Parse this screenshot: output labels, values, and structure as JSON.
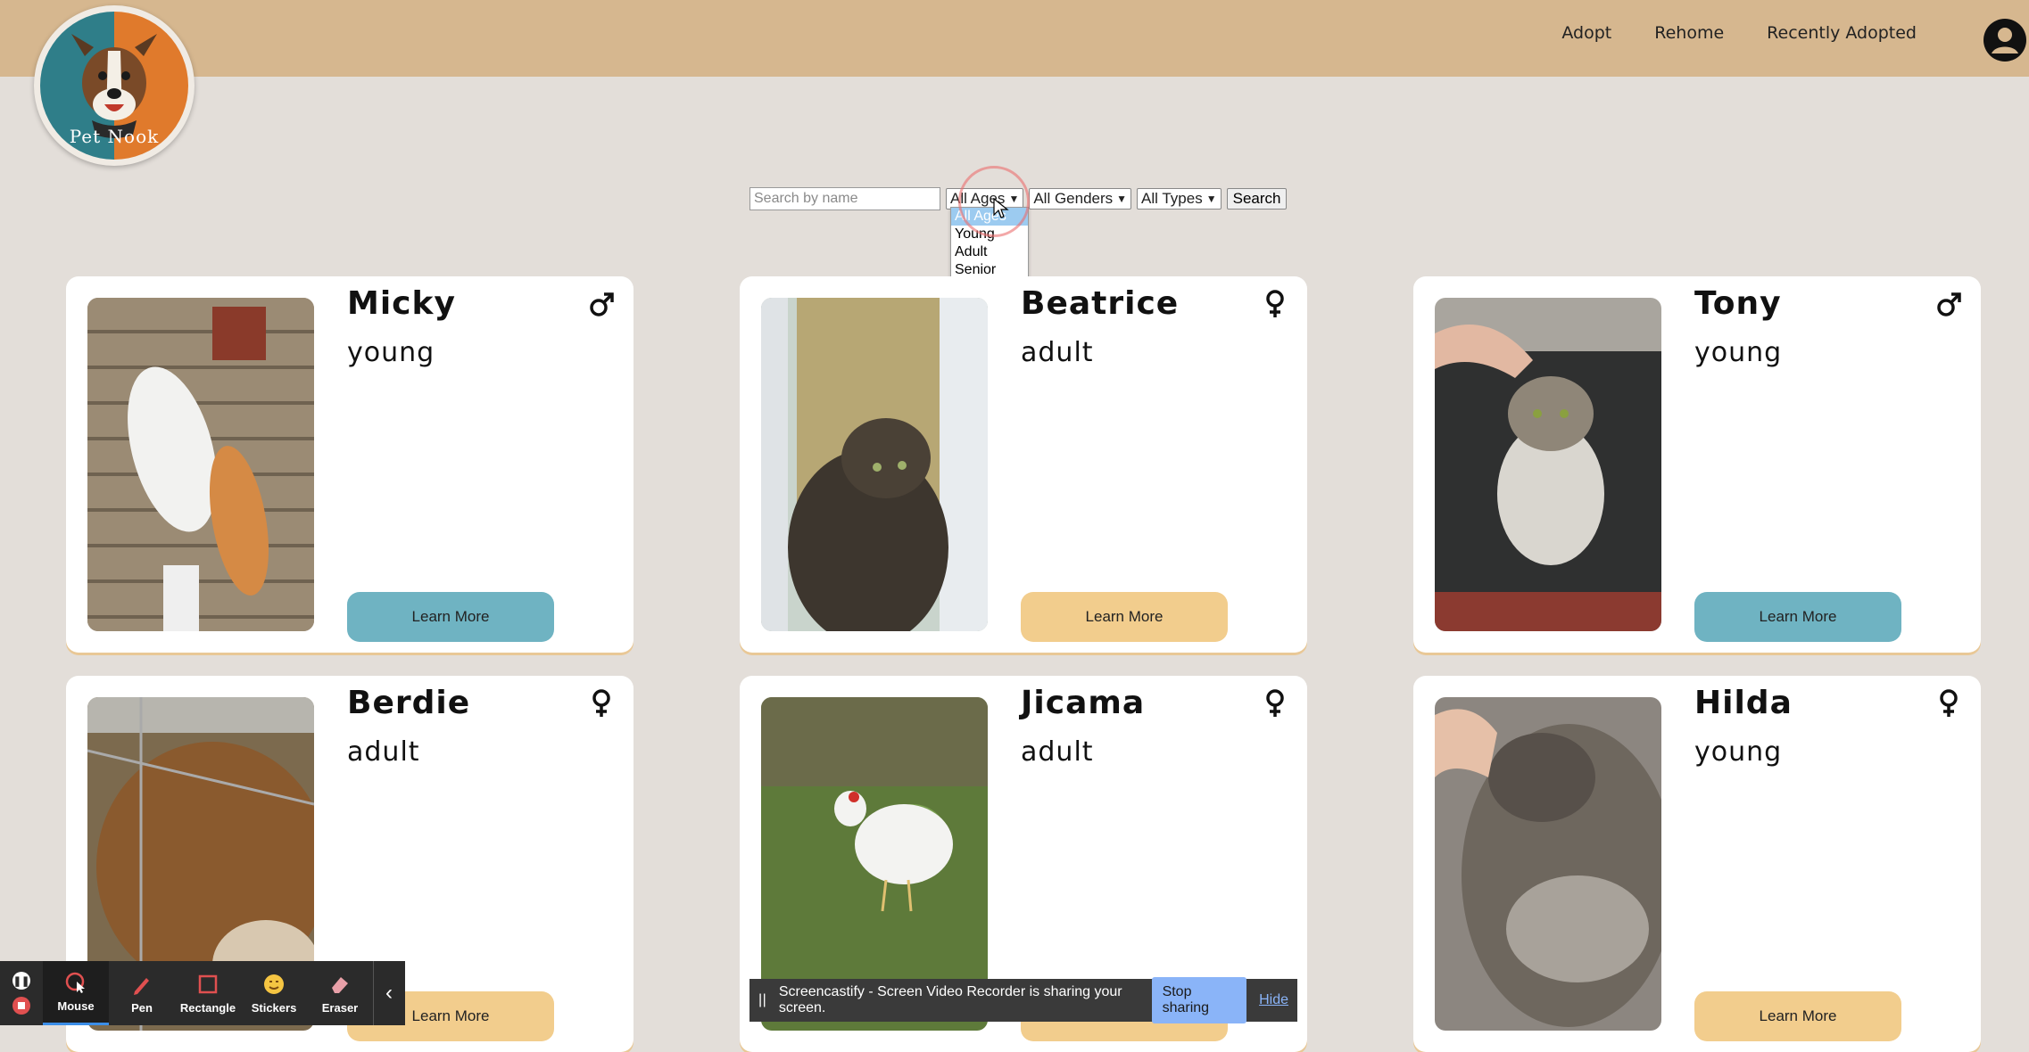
{
  "header": {
    "logo_text": "Pet Nook",
    "nav": [
      "Adopt",
      "Rehome",
      "Recently Adopted"
    ]
  },
  "search": {
    "placeholder": "Search by name",
    "age_selected": "All Ages",
    "gender_selected": "All Genders",
    "type_selected": "All Types",
    "button": "Search"
  },
  "age_dropdown": {
    "options": [
      "All Ages",
      "Young",
      "Adult",
      "Senior"
    ],
    "highlighted": "All Ages"
  },
  "pets": [
    {
      "name": "Micky",
      "age": "young",
      "gender": "male",
      "button": "Learn More",
      "button_color": "#6fb3c2"
    },
    {
      "name": "Beatrice",
      "age": "adult",
      "gender": "female",
      "button": "Learn More",
      "button_color": "#f2cd8d"
    },
    {
      "name": "Tony",
      "age": "young",
      "gender": "male",
      "button": "Learn More",
      "button_color": "#6fb3c2"
    },
    {
      "name": "Berdie",
      "age": "adult",
      "gender": "female",
      "button": "Learn More",
      "button_color": "#f2cd8d"
    },
    {
      "name": "Jicama",
      "age": "adult",
      "gender": "female",
      "button": "Learn More",
      "button_color": "#f2cd8d"
    },
    {
      "name": "Hilda",
      "age": "young",
      "gender": "female",
      "button": "Learn More",
      "button_color": "#f2cd8d"
    }
  ],
  "toolbar": {
    "tools": [
      "Mouse",
      "Pen",
      "Rectangle",
      "Stickers",
      "Eraser"
    ],
    "active": "Mouse"
  },
  "share_bar": {
    "message": "Screencastify - Screen Video Recorder is sharing your screen.",
    "stop": "Stop sharing",
    "hide": "Hide"
  },
  "colors": {
    "header": "#d6b78f",
    "background": "#e3ded9",
    "button_blue": "#6fb3c2",
    "button_orange": "#f2cd8d"
  }
}
